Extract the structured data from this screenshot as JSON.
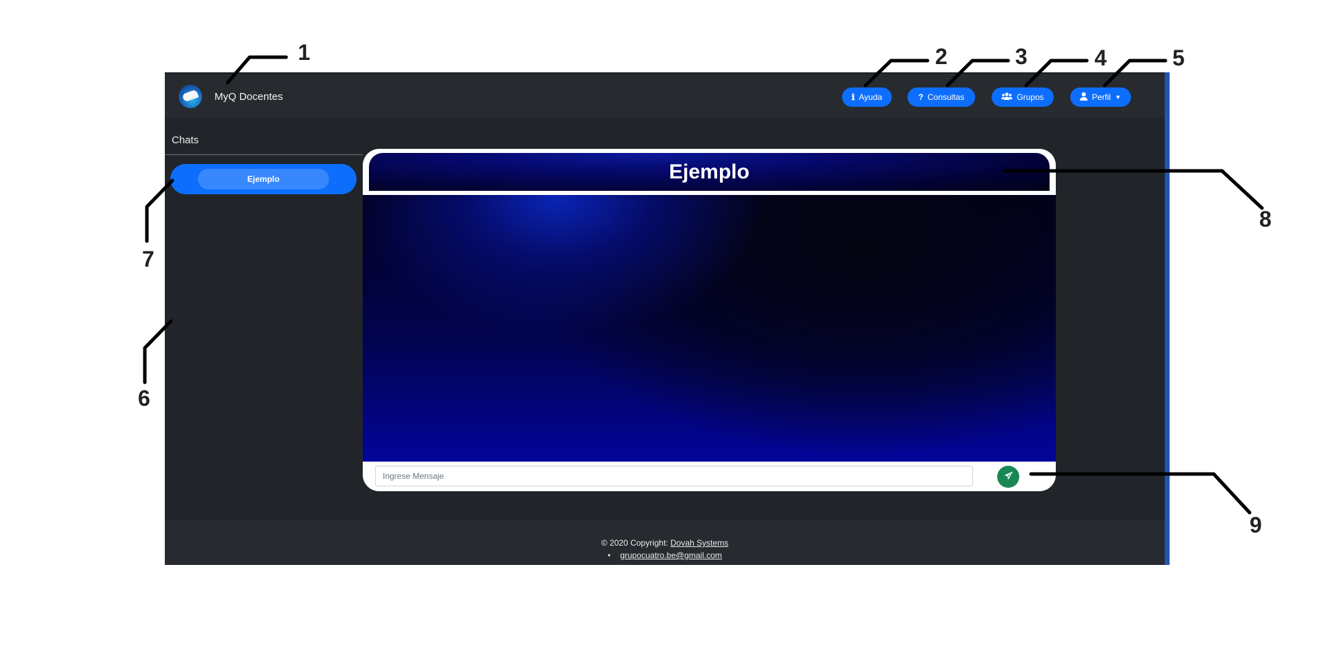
{
  "app": {
    "brand_name": "MyQ Docentes",
    "nav": {
      "help_label": "Ayuda",
      "consult_label": "Consultas",
      "groups_label": "Grupos",
      "profile_label": "Perfil"
    },
    "sidebar": {
      "title": "Chats",
      "items": [
        {
          "label": "Ejemplo"
        }
      ]
    },
    "chat": {
      "title": "Ejemplo",
      "input": {
        "placeholder": "Ingrese Mensaje",
        "value": ""
      }
    },
    "footer": {
      "copyright_prefix": "© 2020 Copyright:",
      "company_link": "Dovah Systems",
      "email": "grupocuatro.be@gmail.com"
    }
  },
  "annotations": {
    "callouts": [
      "1",
      "2",
      "3",
      "4",
      "5",
      "6",
      "7",
      "8",
      "9"
    ]
  },
  "icons": {
    "help": "info-icon",
    "consult": "question-icon",
    "groups": "users-icon",
    "profile": "user-icon",
    "send": "paper-plane-icon"
  },
  "colors": {
    "primary": "#0d6efd",
    "send": "#198754",
    "app_bg": "#212529",
    "navbar_bg": "#272b30"
  }
}
